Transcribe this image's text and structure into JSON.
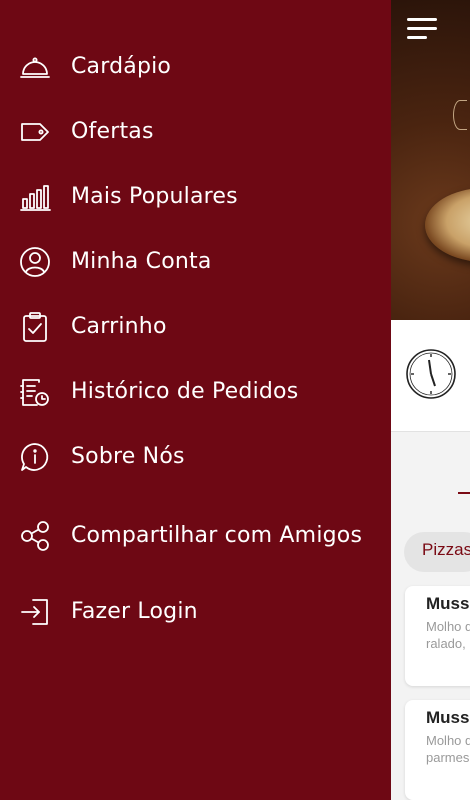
{
  "drawer": {
    "background": "#6e0814",
    "items": [
      {
        "label": "Cardápio",
        "icon": "cloche-icon"
      },
      {
        "label": "Ofertas",
        "icon": "tag-icon"
      },
      {
        "label": "Mais Populares",
        "icon": "bar-chart-icon"
      },
      {
        "label": "Minha Conta",
        "icon": "user-circle-icon"
      },
      {
        "label": "Carrinho",
        "icon": "clipboard-check-icon"
      },
      {
        "label": "Histórico de Pedidos",
        "icon": "order-history-icon"
      },
      {
        "label": "Sobre Nós",
        "icon": "info-bubble-icon"
      },
      {
        "label": "Compartilhar com Amigos",
        "icon": "share-icon"
      },
      {
        "label": "Fazer Login",
        "icon": "login-icon"
      }
    ]
  },
  "background_screen": {
    "category_chip": "Pizzas",
    "cards": [
      {
        "title": "Muss",
        "desc_line1": "Molho d",
        "desc_line2": "ralado,"
      },
      {
        "title": "Muss",
        "desc_line1": "Molho d",
        "desc_line2": "parmes"
      }
    ],
    "accent_color": "#7a0a14"
  }
}
